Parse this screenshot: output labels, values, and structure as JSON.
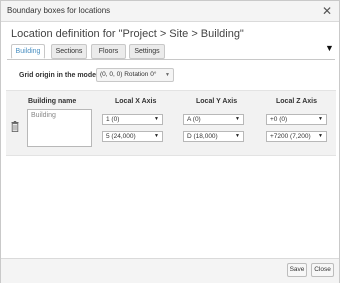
{
  "window": {
    "title": "Boundary boxes for locations",
    "close_glyph": "✕"
  },
  "heading": "Location definition for \"Project > Site > Building\"",
  "tabs": [
    {
      "label": "Building",
      "active": true
    },
    {
      "label": "Sections",
      "active": false
    },
    {
      "label": "Floors",
      "active": false
    },
    {
      "label": "Settings",
      "active": false
    }
  ],
  "collapse_glyph": "▼",
  "grid_origin": {
    "label": "Grid origin in the model",
    "value": "(0, 0, 0)  Rotation 0°"
  },
  "columns": {
    "name": "Building name",
    "x": "Local X Axis",
    "y": "Local Y Axis",
    "z": "Local Z Axis"
  },
  "row": {
    "name_value": "Building",
    "x_start": "1 (0)",
    "x_end": "5 (24,000)",
    "y_start": "A (0)",
    "y_end": "D (18,000)",
    "z_start": "+0 (0)",
    "z_end": "+7200 (7,200)"
  },
  "footer": {
    "save_label": "Save",
    "close_label": "Close"
  },
  "icons": {
    "delete_row": "trash-icon",
    "dropdown": "caret-down-icon"
  },
  "colors": {
    "active_tab": "#4a90c2",
    "panel_bg": "#f2f2f2"
  }
}
